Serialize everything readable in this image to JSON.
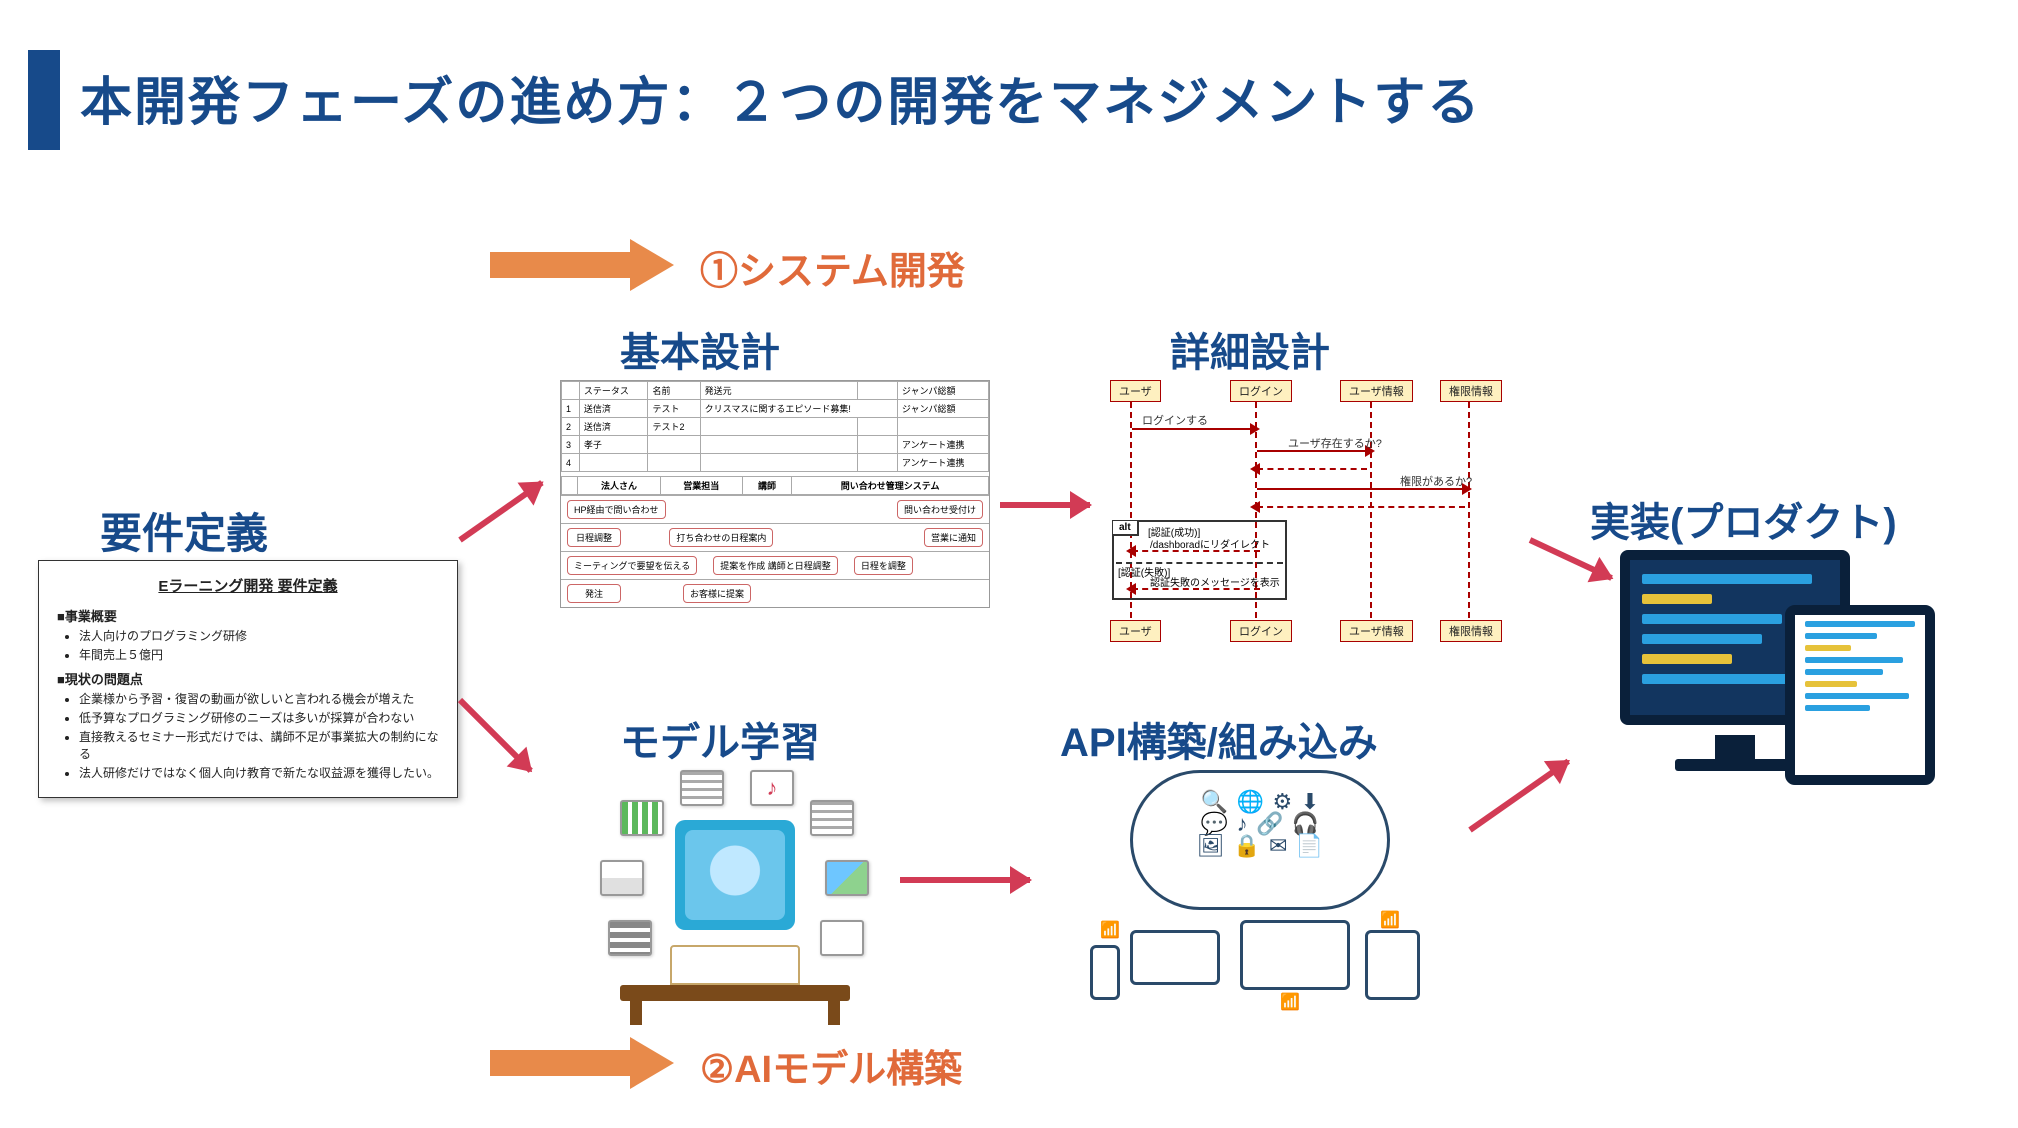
{
  "title": "本開発フェーズの進め方：２つの開発をマネジメントする",
  "flows": {
    "top": "①システム開発",
    "bottom": "②AIモデル構築"
  },
  "stages": {
    "requirements": "要件定義",
    "basic_design": "基本設計",
    "detailed_design": "詳細設計",
    "model_training": "モデル学習",
    "api_build": "API構築/組み込み",
    "implementation": "実装(プロダクト)"
  },
  "requirements_doc": {
    "title": "Eラーニング開発 要件定義",
    "section1": "■事業概要",
    "s1_items": [
      "法人向けのプログラミング研修",
      "年間売上５億円"
    ],
    "section2": "■現状の問題点",
    "s2_items": [
      "企業様から予習・復習の動画が欲しいと言われる機会が増えた",
      "低予算なプログラミング研修のニーズは多いが採算が合わない",
      "直接教えるセミナー形式だけでは、講師不足が事業拡大の制約になる",
      "法人研修だけではなく個人向け教育で新たな収益源を獲得したい。"
    ]
  },
  "basic_design_panel": {
    "cols": [
      "法人さん",
      "営業担当",
      "講師",
      "問い合わせ管理システム"
    ],
    "rows": [
      [
        "HP経由で問い合わせ",
        "",
        "",
        "問い合わせ受付け"
      ],
      [
        "日程調整",
        "打ち合わせの日程案内",
        "",
        "営業に通知"
      ],
      [
        "ミーティングで要望を伝える",
        "提案を作成 講師と日程調整",
        "日程を調整",
        ""
      ],
      [
        "発注",
        "お客様に提案",
        "",
        ""
      ]
    ]
  },
  "sequence_panel": {
    "actors": [
      "ユーザ",
      "ログイン",
      "ユーザ情報",
      "権限情報"
    ],
    "messages": {
      "login": "ログインする",
      "user_exists": "ユーザ存在するか?",
      "has_auth": "権限があるか?",
      "alt": "alt",
      "success": "[認証(成功)]",
      "redirect": "/dashboradにリダイレクト",
      "fail": "[認証(失敗)]",
      "fail_msg": "認証失敗のメッセージを表示"
    }
  }
}
